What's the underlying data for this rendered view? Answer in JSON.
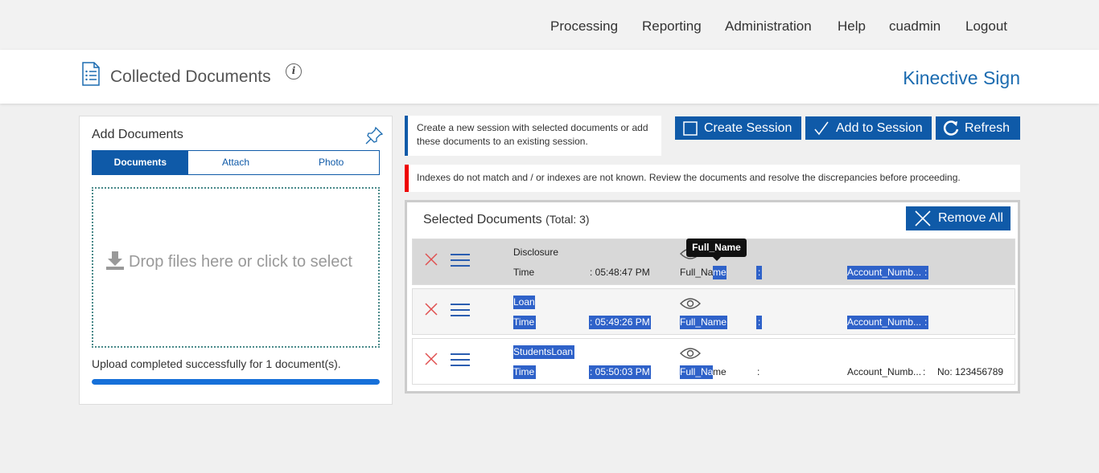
{
  "nav": {
    "items": [
      "Processing",
      "Reporting",
      "Administration",
      "Help",
      "cuadmin",
      "Logout"
    ]
  },
  "header": {
    "title": "Collected Documents",
    "info_glyph": "i",
    "brand": "Kinective Sign"
  },
  "add_documents": {
    "title": "Add Documents",
    "tabs": [
      "Documents",
      "Attach",
      "Photo"
    ],
    "active_tab": "Documents",
    "dropzone_text": "Drop files here or click to select",
    "upload_status": "Upload completed successfully for 1 document(s).",
    "progress": 1.0
  },
  "session_info": "Create a new session with selected documents or add these documents to an existing session.",
  "buttons": {
    "create": "Create Session",
    "add": "Add to Session",
    "refresh": "Refresh",
    "remove_all": "Remove All"
  },
  "warning": "Indexes do not match and / or indexes are not known. Review the documents and resolve the discrepancies before proceeding.",
  "selected": {
    "title": "Selected Documents",
    "total": "(Total: 3)",
    "tooltip": "Full_Name",
    "rows": [
      {
        "name": "Disclosure",
        "time_label": "Time",
        "time": ": 05:48:47 PM",
        "field1_a": "Full_Na",
        "field1_b": "me",
        "colon": ":",
        "field2": "Account_Numb...",
        "field2_sep": ":",
        "field2_value": ""
      },
      {
        "name": "Loan",
        "time_label": "Time",
        "time": ": 05:49:26 PM",
        "field1_a": "Full_Name",
        "field1_b": "",
        "colon": ":",
        "field2": "Account_Numb...",
        "field2_sep": ":",
        "field2_value": ""
      },
      {
        "name": "StudentsLoan",
        "time_label": "Time",
        "time": ": 05:50:03 PM",
        "field1_a": "Full_Na",
        "field1_b": "me",
        "colon": ":",
        "field2": "Account_Numb...",
        "field2_sep": ":",
        "field2_value": "No: 123456789"
      }
    ]
  },
  "colors": {
    "primary": "#0f5aa8",
    "brand": "#1b6bb0",
    "warning": "#ee0000",
    "highlight": "#2f62c9",
    "progress": "#1670d9"
  },
  "icons": [
    "document-list-icon",
    "info-icon",
    "pin-icon",
    "download-icon",
    "checkbox-icon",
    "checkmark-icon",
    "refresh-icon",
    "close-icon",
    "remove-icon",
    "menu-icon",
    "eye-icon"
  ]
}
